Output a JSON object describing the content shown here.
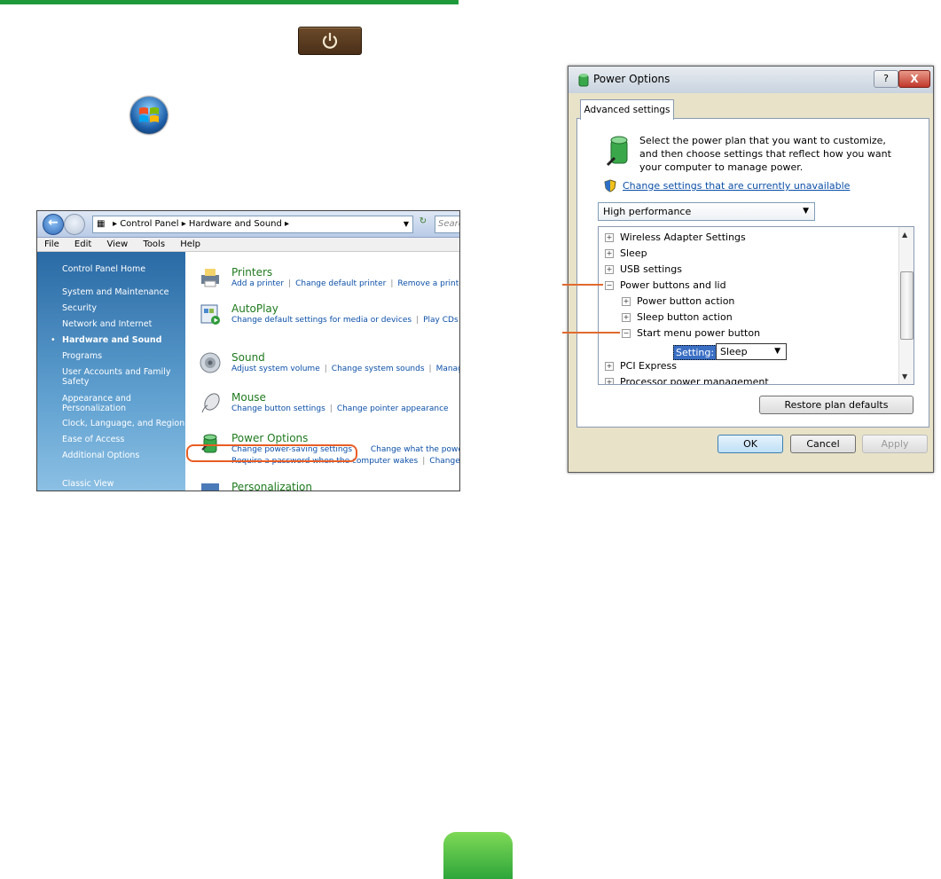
{
  "control_panel": {
    "breadcrumb": [
      "Control Panel",
      "Hardware and Sound"
    ],
    "search_placeholder": "Search",
    "menu": [
      "File",
      "Edit",
      "View",
      "Tools",
      "Help"
    ],
    "sidebar": {
      "home": "Control Panel Home",
      "items": [
        "System and Maintenance",
        "Security",
        "Network and Internet",
        "Hardware and Sound",
        "Programs",
        "User Accounts and Family Safety",
        "Appearance and Personalization",
        "Clock, Language, and Region",
        "Ease of Access",
        "Additional Options"
      ],
      "selected": "Hardware and Sound",
      "classic_view": "Classic View"
    },
    "categories": [
      {
        "title": "Printers",
        "links": [
          "Add a printer",
          "Change default printer",
          "Remove a printe"
        ]
      },
      {
        "title": "AutoPlay",
        "links": [
          "Change default settings for media or devices",
          "Play CDs or"
        ]
      },
      {
        "title": "Sound",
        "links": [
          "Adjust system volume",
          "Change system sounds",
          "Manag"
        ]
      },
      {
        "title": "Mouse",
        "links": [
          "Change button settings",
          "Change pointer appearance"
        ]
      },
      {
        "title": "Power Options",
        "links": [
          "Change power-saving settings",
          "Change what the power b"
        ],
        "links2": [
          "Require a password when the computer wakes",
          "Change w"
        ]
      },
      {
        "title": "Personalization"
      }
    ]
  },
  "power_options": {
    "title": "Power Options",
    "help": "?",
    "close": "X",
    "tab": "Advanced settings",
    "intro": "Select the power plan that you want to customize, and then choose settings that reflect how you want your computer to manage power.",
    "change_link": "Change settings that are currently unavailable",
    "plan": "High performance",
    "tree": [
      {
        "label": "Wireless Adapter Settings",
        "state": "+",
        "level": 0
      },
      {
        "label": "Sleep",
        "state": "+",
        "level": 0
      },
      {
        "label": "USB settings",
        "state": "+",
        "level": 0
      },
      {
        "label": "Power buttons and lid",
        "state": "-",
        "level": 0
      },
      {
        "label": "Power button action",
        "state": "+",
        "level": 1
      },
      {
        "label": "Sleep button action",
        "state": "+",
        "level": 1
      },
      {
        "label": "Start menu power button",
        "state": "-",
        "level": 1
      },
      {
        "label": "PCI Express",
        "state": "+",
        "level": 0
      },
      {
        "label": "Processor power management",
        "state": "+",
        "level": 0
      }
    ],
    "setting_label": "Setting:",
    "setting_value": "Sleep",
    "restore_button": "Restore plan defaults",
    "ok": "OK",
    "cancel": "Cancel",
    "apply": "Apply"
  },
  "colors": {
    "accent_green": "#1f9a3a",
    "highlight_orange": "#e85d25"
  }
}
